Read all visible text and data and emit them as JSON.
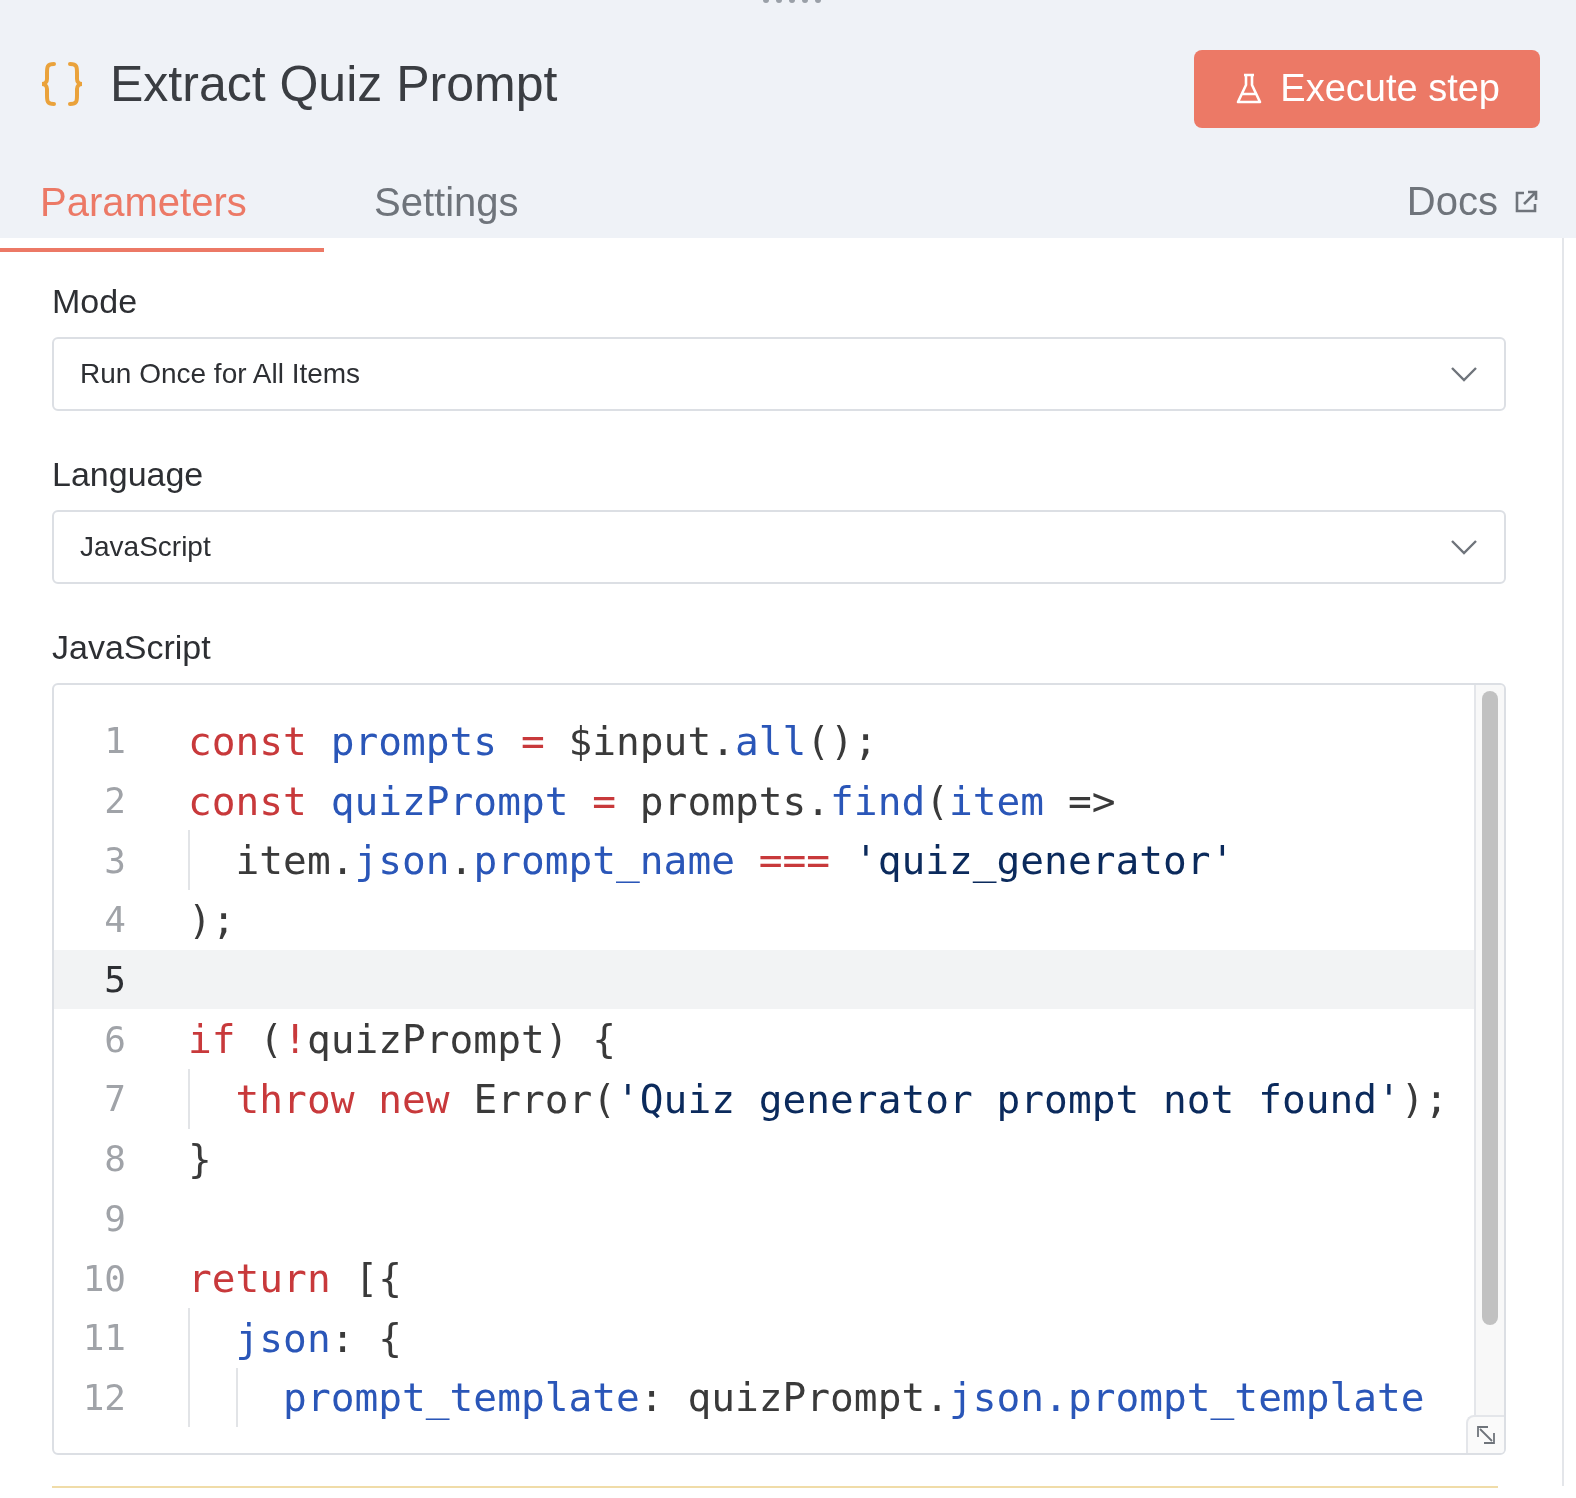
{
  "header": {
    "title": "Extract Quiz Prompt",
    "execute_button": "Execute step"
  },
  "tabs": [
    {
      "label": "Parameters",
      "selected": true
    },
    {
      "label": "Settings",
      "selected": false
    }
  ],
  "docs_link": "Docs",
  "fields": [
    {
      "label": "Mode",
      "value": "Run Once for All Items"
    },
    {
      "label": "Language",
      "value": "JavaScript"
    }
  ],
  "code_editor": {
    "label": "JavaScript",
    "lines": [
      {
        "number": "1",
        "active": false,
        "tokens": [
          {
            "kind": "keyword",
            "text": "const "
          },
          {
            "kind": "variable",
            "text": "prompts "
          },
          {
            "kind": "operator",
            "text": "= "
          },
          {
            "kind": "plain",
            "text": "$input."
          },
          {
            "kind": "variable",
            "text": "all"
          },
          {
            "kind": "plain",
            "text": "();"
          }
        ]
      },
      {
        "number": "2",
        "active": false,
        "tokens": [
          {
            "kind": "keyword",
            "text": "const "
          },
          {
            "kind": "variable",
            "text": "quizPrompt "
          },
          {
            "kind": "operator",
            "text": "= "
          },
          {
            "kind": "plain",
            "text": "prompts."
          },
          {
            "kind": "variable",
            "text": "find"
          },
          {
            "kind": "plain",
            "text": "("
          },
          {
            "kind": "variable",
            "text": "item "
          },
          {
            "kind": "plain",
            "text": "=>"
          }
        ]
      },
      {
        "number": "3",
        "active": false,
        "tokens": [
          {
            "kind": "plain",
            "text": "  item."
          },
          {
            "kind": "variable",
            "text": "json"
          },
          {
            "kind": "plain",
            "text": "."
          },
          {
            "kind": "variable",
            "text": "prompt_name "
          },
          {
            "kind": "operator",
            "text": "=== "
          },
          {
            "kind": "string",
            "text": "'quiz_generator'"
          }
        ]
      },
      {
        "number": "4",
        "active": false,
        "tokens": [
          {
            "kind": "plain",
            "text": ");"
          }
        ]
      },
      {
        "number": "5",
        "active": true
      },
      {
        "number": "6",
        "active": false,
        "tokens": [
          {
            "kind": "keyword",
            "text": "if "
          },
          {
            "kind": "plain",
            "text": "("
          },
          {
            "kind": "operator",
            "text": "!"
          },
          {
            "kind": "plain",
            "text": "quizPrompt) {"
          }
        ]
      },
      {
        "number": "7",
        "active": false,
        "tokens": [
          {
            "kind": "keyword",
            "text": "  throw "
          },
          {
            "kind": "keyword",
            "text": "new "
          },
          {
            "kind": "plain",
            "text": "Error("
          },
          {
            "kind": "string",
            "text": "'Quiz generator prompt not found'"
          },
          {
            "kind": "plain",
            "text": ");"
          }
        ]
      },
      {
        "number": "8",
        "active": false,
        "tokens": [
          {
            "kind": "plain",
            "text": "}"
          }
        ]
      },
      {
        "number": "9",
        "active": false
      },
      {
        "number": "10",
        "active": false,
        "tokens": [
          {
            "kind": "keyword",
            "text": "return "
          },
          {
            "kind": "plain",
            "text": "[{"
          }
        ]
      },
      {
        "number": "11",
        "active": false,
        "tokens": [
          {
            "kind": "variable",
            "text": "  json"
          },
          {
            "kind": "plain",
            "text": ": {"
          }
        ]
      },
      {
        "number": "12",
        "active": false,
        "tokens": [
          {
            "kind": "variable",
            "text": "    prompt_template"
          },
          {
            "kind": "plain",
            "text": ": quizPrompt."
          },
          {
            "kind": "variable",
            "text": "json.prompt_template"
          }
        ]
      }
    ]
  }
}
